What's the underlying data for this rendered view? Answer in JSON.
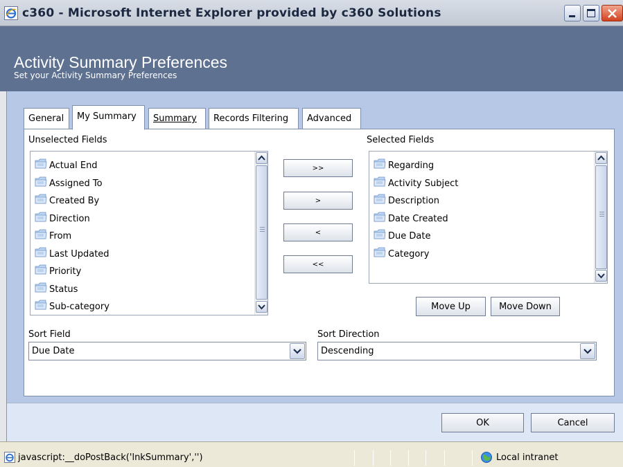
{
  "window": {
    "title": "c360 - Microsoft Internet Explorer provided by c360 Solutions"
  },
  "header": {
    "title": "Activity Summary Preferences",
    "subtitle": "Set your Activity Summary Preferences"
  },
  "tabs": [
    {
      "label": "General",
      "active": false
    },
    {
      "label": "My Summary",
      "active": true
    },
    {
      "label": "Summary",
      "active": false,
      "link": true
    },
    {
      "label": "Records Filtering",
      "active": false
    },
    {
      "label": "Advanced",
      "active": false
    }
  ],
  "unselected": {
    "label": "Unselected Fields",
    "items": [
      "Actual End",
      "Assigned To",
      "Created By",
      "Direction",
      "From",
      "Last Updated",
      "Priority",
      "Status",
      "Sub-category"
    ]
  },
  "selected": {
    "label": "Selected Fields",
    "items": [
      "Regarding",
      "Activity Subject",
      "Description",
      "Date Created",
      "Due Date",
      "Category"
    ]
  },
  "transfer_buttons": {
    "add_all": ">>",
    "add": ">",
    "remove": "<",
    "remove_all": "<<"
  },
  "order_buttons": {
    "move_up": "Move Up",
    "move_down": "Move Down"
  },
  "sort_field": {
    "label": "Sort Field",
    "value": "Due Date"
  },
  "sort_direction": {
    "label": "Sort Direction",
    "value": "Descending"
  },
  "footer": {
    "ok": "OK",
    "cancel": "Cancel"
  },
  "statusbar": {
    "text": "javascript:__doPostBack('lnkSummary','')",
    "zone": "Local intranet"
  },
  "colors": {
    "header_bg": "#5e7191",
    "body_bg": "#b6c8e6",
    "footer_bg": "#dde7f5"
  }
}
